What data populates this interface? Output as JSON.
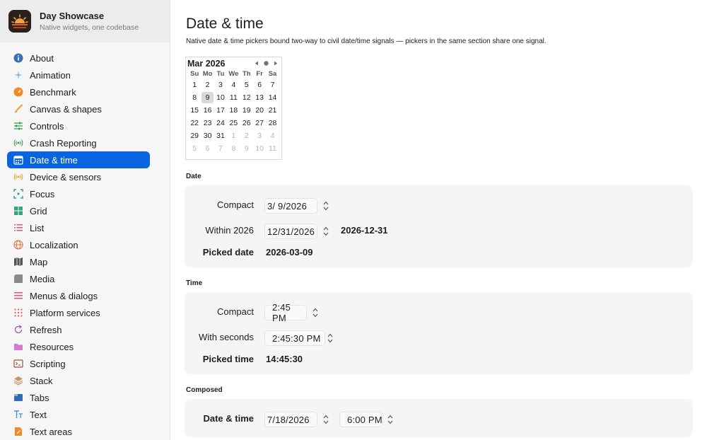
{
  "app": {
    "title": "Day Showcase",
    "subtitle": "Native widgets, one codebase"
  },
  "sidebar": {
    "items": [
      {
        "label": "About",
        "icon": "info-icon",
        "color": "#3a6fb5"
      },
      {
        "label": "Animation",
        "icon": "sparkles-icon",
        "color": "#7fb7e6"
      },
      {
        "label": "Benchmark",
        "icon": "speedometer-icon",
        "color": "#f08a24"
      },
      {
        "label": "Canvas & shapes",
        "icon": "paintbrush-icon",
        "color": "#f0a030"
      },
      {
        "label": "Controls",
        "icon": "sliders-icon",
        "color": "#3aa356"
      },
      {
        "label": "Crash Reporting",
        "icon": "broadcast-icon",
        "color": "#3aa356"
      },
      {
        "label": "Date & time",
        "icon": "calendar-icon",
        "color": "#ffffff",
        "active": true
      },
      {
        "label": "Device & sensors",
        "icon": "sensor-icon",
        "color": "#f0a030"
      },
      {
        "label": "Focus",
        "icon": "viewfinder-icon",
        "color": "#2aa39a"
      },
      {
        "label": "Grid",
        "icon": "grid-icon",
        "color": "#3aa37a"
      },
      {
        "label": "List",
        "icon": "list-icon",
        "color": "#e0566b"
      },
      {
        "label": "Localization",
        "icon": "globe-icon",
        "color": "#e0703b"
      },
      {
        "label": "Map",
        "icon": "map-icon",
        "color": "#555555"
      },
      {
        "label": "Media",
        "icon": "film-icon",
        "color": "#8a8a8a"
      },
      {
        "label": "Menus & dialogs",
        "icon": "menu-icon",
        "color": "#e0566b"
      },
      {
        "label": "Platform services",
        "icon": "dots-grid-icon",
        "color": "#e0566b"
      },
      {
        "label": "Refresh",
        "icon": "refresh-icon",
        "color": "#9b59b6"
      },
      {
        "label": "Resources",
        "icon": "folder-icon",
        "color": "#d67ad0"
      },
      {
        "label": "Scripting",
        "icon": "terminal-icon",
        "color": "#a0522d"
      },
      {
        "label": "Stack",
        "icon": "stack-icon",
        "color": "#c8956b"
      },
      {
        "label": "Tabs",
        "icon": "tabs-icon",
        "color": "#2e6db4"
      },
      {
        "label": "Text",
        "icon": "text-icon",
        "color": "#4a90c8"
      },
      {
        "label": "Text areas",
        "icon": "doc-edit-icon",
        "color": "#f08a24"
      }
    ]
  },
  "main": {
    "title": "Date & time",
    "description": "Native date & time pickers bound two-way to civil date/time signals — pickers in the same section share one signal."
  },
  "calendar": {
    "month": "Mar 2026",
    "weekdays": [
      "Su",
      "Mo",
      "Tu",
      "We",
      "Th",
      "Fr",
      "Sa"
    ],
    "weeks": [
      [
        "1",
        "2",
        "3",
        "4",
        "5",
        "6",
        "7"
      ],
      [
        "8",
        "9",
        "10",
        "11",
        "12",
        "13",
        "14"
      ],
      [
        "15",
        "16",
        "17",
        "18",
        "19",
        "20",
        "21"
      ],
      [
        "22",
        "23",
        "24",
        "25",
        "26",
        "27",
        "28"
      ],
      [
        "29",
        "30",
        "31",
        "1",
        "2",
        "3",
        "4"
      ],
      [
        "5",
        "6",
        "7",
        "8",
        "9",
        "10",
        "11"
      ]
    ],
    "selected_day": "9"
  },
  "sections": {
    "date": {
      "label": "Date",
      "compact_label": "Compact",
      "compact_value": "3/  9/2026",
      "within_label": "Within 2026",
      "within_value": "12/31/2026",
      "within_display": "2026-12-31",
      "picked_label": "Picked date",
      "picked_value": "2026-03-09"
    },
    "time": {
      "label": "Time",
      "compact_label": "Compact",
      "compact_value": "2:45 PM",
      "seconds_label": "With seconds",
      "seconds_value": "2:45:30 PM",
      "picked_label": "Picked time",
      "picked_value": "14:45:30"
    },
    "composed": {
      "label": "Composed",
      "datetime_label": "Date & time",
      "date_value": "7/18/2026",
      "time_value": "6:00 PM"
    }
  },
  "colors": {
    "accent": "#0a64e0",
    "card": "#f5f5f5",
    "sidebar": "#f6f6f6"
  }
}
